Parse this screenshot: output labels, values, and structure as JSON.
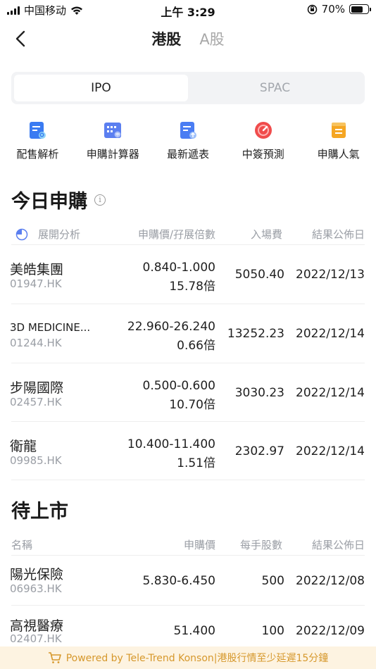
{
  "status_bar": {
    "carrier": "中国移动",
    "time": "上午 3:29",
    "battery": "70%",
    "battery_level": 0.7
  },
  "nav": {
    "tabs": [
      {
        "label": "港股",
        "active": true
      },
      {
        "label": "A股",
        "active": false
      }
    ]
  },
  "segment": {
    "options": [
      {
        "label": "IPO",
        "active": true
      },
      {
        "label": "SPAC",
        "active": false
      }
    ]
  },
  "tools": [
    {
      "label": "配售解析",
      "icon": "doc-search-icon",
      "color": "#3a7bf2"
    },
    {
      "label": "申購計算器",
      "icon": "calculator-icon",
      "color": "#5b7ff0"
    },
    {
      "label": "最新遞表",
      "icon": "doc-upload-icon",
      "color": "#4a7df3"
    },
    {
      "label": "中簽預測",
      "icon": "gauge-icon",
      "color": "#f04c4c"
    },
    {
      "label": "申購人氣",
      "icon": "popularity-icon",
      "color": "#f5a623"
    }
  ],
  "today": {
    "title": "今日申購",
    "headers": {
      "analysis": "展開分析",
      "price": "申購價/孖展倍數",
      "fee": "入場費",
      "date": "結果公佈日"
    },
    "rows": [
      {
        "name": "美皓集團",
        "code": "01947.HK",
        "price": "0.840-1.000",
        "multiple": "15.78倍",
        "fee": "5050.40",
        "date": "2022/12/13"
      },
      {
        "name": "3D MEDICINE...",
        "code": "01244.HK",
        "price": "22.960-26.240",
        "multiple": "0.66倍",
        "fee": "13252.23",
        "date": "2022/12/14"
      },
      {
        "name": "步陽國際",
        "code": "02457.HK",
        "price": "0.500-0.600",
        "multiple": "10.70倍",
        "fee": "3030.23",
        "date": "2022/12/14"
      },
      {
        "name": "衛龍",
        "code": "09985.HK",
        "price": "10.400-11.400",
        "multiple": "1.51倍",
        "fee": "2302.97",
        "date": "2022/12/14"
      }
    ]
  },
  "upcoming": {
    "title": "待上市",
    "headers": {
      "name": "名稱",
      "price": "申購價",
      "lot": "每手股數",
      "date": "結果公佈日"
    },
    "rows": [
      {
        "name": "陽光保險",
        "code": "06963.HK",
        "price": "5.830-6.450",
        "lot": "500",
        "date": "2022/12/08"
      },
      {
        "name": "高視醫療",
        "code": "02407.HK",
        "price": "51.400",
        "lot": "100",
        "date": "2022/12/09"
      }
    ]
  },
  "footer": {
    "text": "Powered by Tele-Trend Konson|港股行情至少延遲15分鐘"
  }
}
